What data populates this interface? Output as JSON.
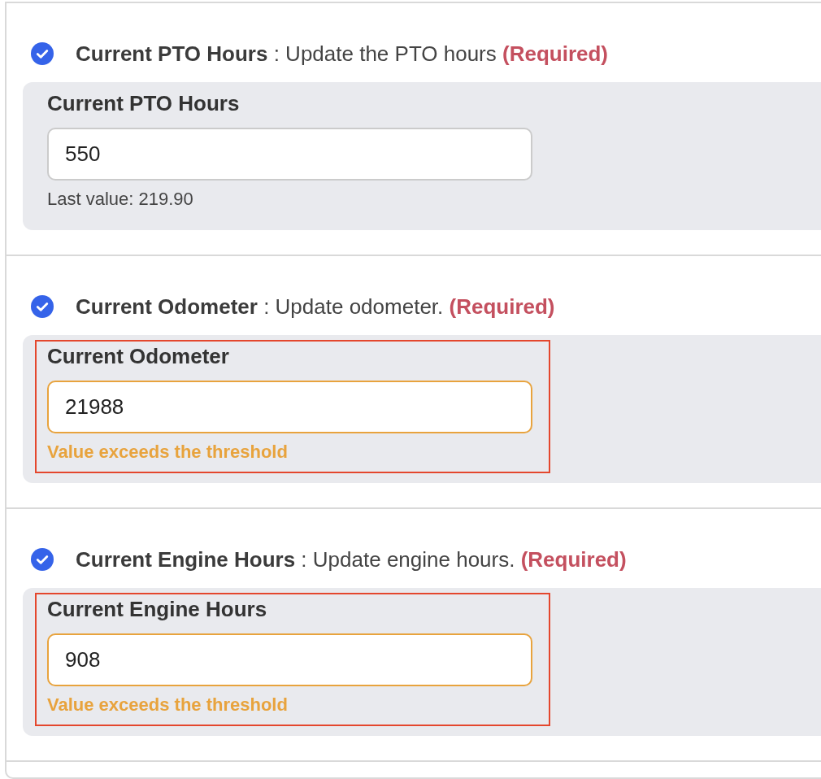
{
  "sections": [
    {
      "checked": true,
      "title": "Current PTO Hours",
      "description": ": Update the PTO hours",
      "required_label": "(Required)",
      "field": {
        "label": "Current PTO Hours",
        "value": "550",
        "flagged": false,
        "note": "Last value: 219.90"
      }
    },
    {
      "checked": true,
      "title": "Current Odometer",
      "description": ": Update odometer.",
      "required_label": "(Required)",
      "field": {
        "label": "Current Odometer",
        "value": "21988",
        "flagged": true,
        "note": "Value exceeds the threshold"
      }
    },
    {
      "checked": true,
      "title": "Current Engine Hours",
      "description": ": Update engine hours.",
      "required_label": "(Required)",
      "field": {
        "label": "Current Engine Hours",
        "value": "908",
        "flagged": true,
        "note": "Value exceeds the threshold"
      }
    }
  ]
}
